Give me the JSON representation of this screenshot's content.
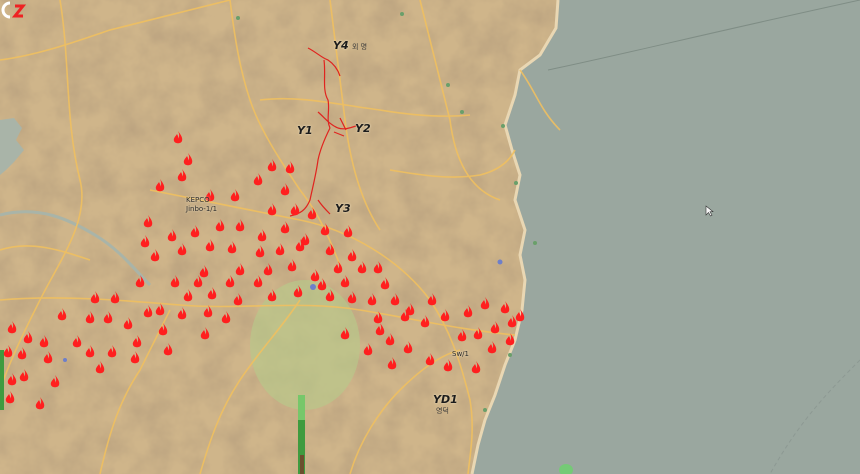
{
  "colors": {
    "land": "#cfb58a",
    "sea": "#9aa79f",
    "road": "#f0c060",
    "fire": "#ff1f1f",
    "burn_area": "#b7c98b"
  },
  "labels": {
    "y4": "Y4",
    "y4_kor": "외 명 ",
    "y1": "Y1",
    "y2": "Y2",
    "y3": "Y3",
    "kepco": "KEPCO",
    "kepco_sub": "Jinbo-1/1",
    "yd1": "YD1",
    "yd1_kor": "영덕",
    "sw": "Sw/1"
  },
  "icons": {
    "fire": "fire-icon",
    "cursor": "cursor-icon",
    "logo": "broadcaster-logo-icon"
  }
}
